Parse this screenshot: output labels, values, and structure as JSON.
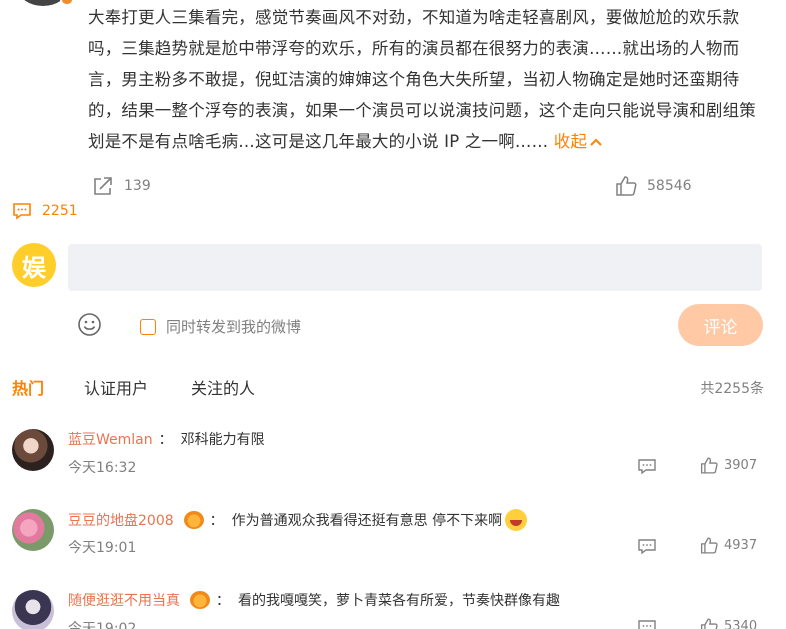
{
  "post": {
    "text": "大奉打更人三集看完，感觉节奏画风不对劲，不知道为啥走轻喜剧风，要做尬尬的欢乐款吗，三集趋势就是尬中带浮夸的欢乐，所有的演员都在很努力的表演……就出场的人物而言，男主粉多不敢提，倪虹洁演的婶婶这个角色大失所望，当初人物确定是她时还蛮期待的，结果一整个浮夸的表演，如果一个演员可以说演技问题，这个走向只能说导演和剧组策划是不是有点啥毛病…这可是这几年最大的小说 IP 之一啊……",
    "collapse_label": "收起",
    "share_count": "139",
    "comment_count": "2251",
    "like_count": "58546"
  },
  "composer": {
    "avatar_char": "娱",
    "repost_label": "同时转发到我的微博",
    "submit_label": "评论"
  },
  "tabs": {
    "hot": "热门",
    "verified": "认证用户",
    "following": "关注的人",
    "total": "共2255条"
  },
  "comments": [
    {
      "user": "蓝豆Wemlan",
      "sep": "：",
      "text": "邓科能力有限",
      "time": "今天16:32",
      "likes": "3907"
    },
    {
      "user": "豆豆的地盘2008",
      "sep": "：",
      "text": "作为普通观众我看得还挺有意思 停不下来啊",
      "time": "今天19:01",
      "likes": "4937"
    },
    {
      "user": "随便逛逛不用当真",
      "sep": "：",
      "text": "看的我嘎嘎笑，萝卜青菜各有所爱，节奏快群像有趣",
      "time": "今天19:02",
      "likes": "5340"
    }
  ],
  "colors": {
    "accent": "#ff8200",
    "username": "#eb7350",
    "submit_bg": "#ffc9a6",
    "input_bg": "#f0f1f4"
  }
}
